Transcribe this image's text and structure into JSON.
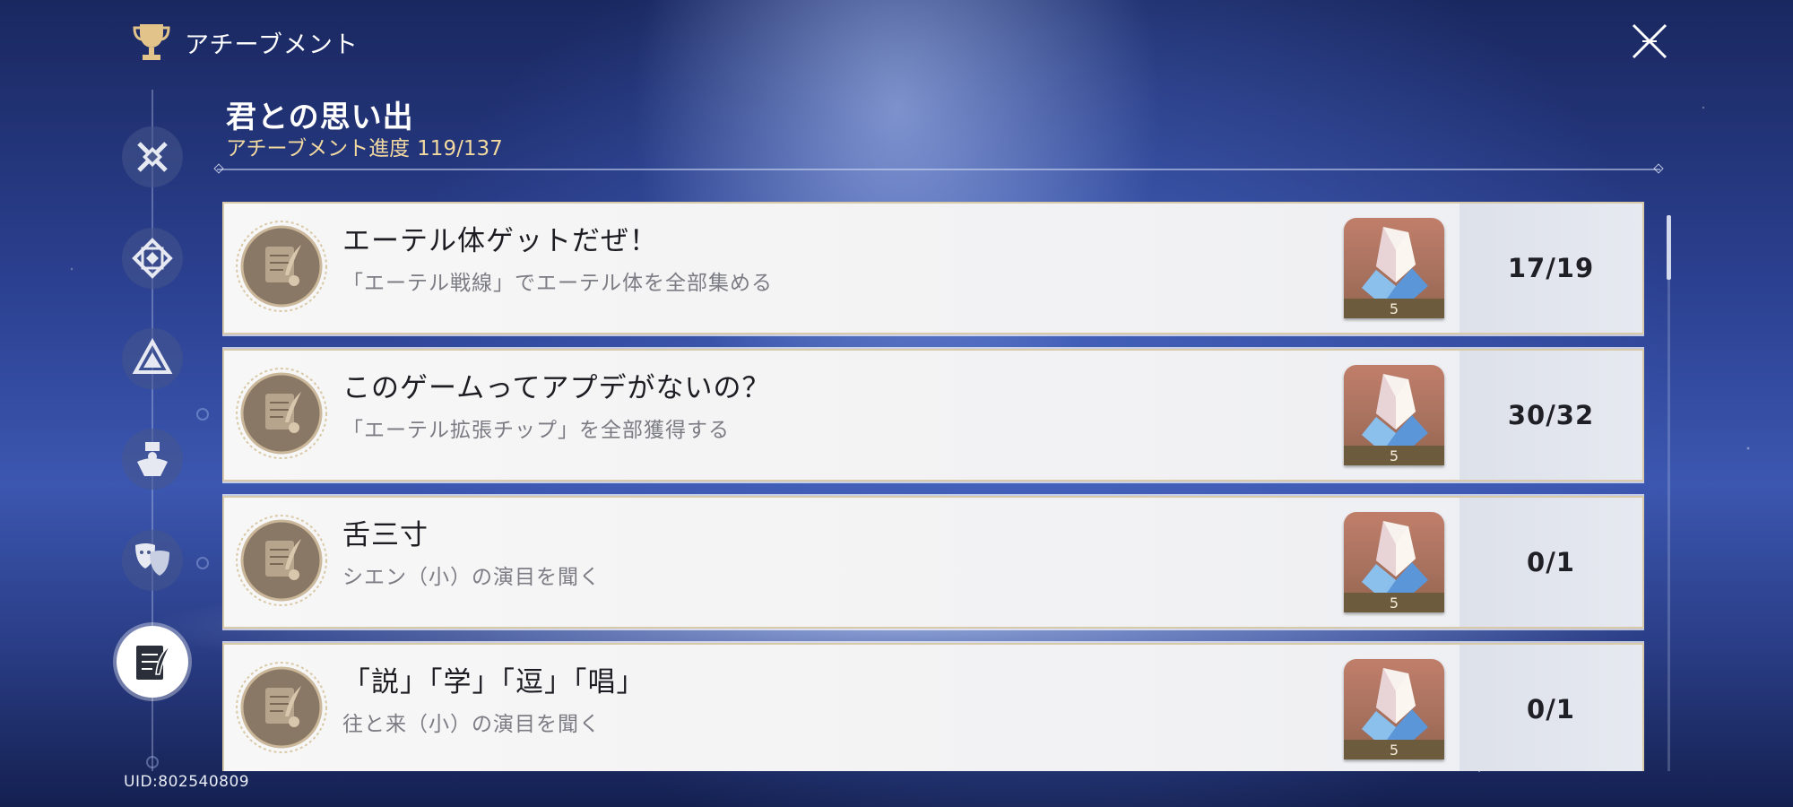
{
  "header": {
    "title": "アチーブメント",
    "icon": "trophy-icon"
  },
  "close": {
    "icon": "close-icon"
  },
  "sidebar": {
    "items": [
      {
        "icon": "crossed-swords-icon",
        "active": false
      },
      {
        "icon": "diamond-emblem-icon",
        "active": false
      },
      {
        "icon": "triangle-emblem-icon",
        "active": false
      },
      {
        "icon": "figure-emblem-icon",
        "active": false
      },
      {
        "icon": "theater-masks-icon",
        "active": false
      },
      {
        "icon": "notebook-quill-icon",
        "active": true
      }
    ]
  },
  "section": {
    "title": "君との思い出",
    "progress_label": "アチーブメント進度",
    "progress_value": "119/137"
  },
  "achievements": [
    {
      "title": "エーテル体ゲットだぜ！",
      "description": "「エーテル戦線」でエーテル体を全部集める",
      "reward_qty": "5",
      "count": "17/19",
      "reward_icon": "crystal-icon",
      "badge_icon": "notebook-badge-icon"
    },
    {
      "title": "このゲームってアプデがないの？",
      "description": "「エーテル拡張チップ」を全部獲得する",
      "reward_qty": "5",
      "count": "30/32",
      "reward_icon": "crystal-icon",
      "badge_icon": "notebook-badge-icon"
    },
    {
      "title": "舌三寸",
      "description": "シエン（小）の演目を聞く",
      "reward_qty": "5",
      "count": "0/1",
      "reward_icon": "crystal-icon",
      "badge_icon": "notebook-badge-icon"
    },
    {
      "title": "「説」「学」「逗」「唱」",
      "description": "往と来（小）の演目を聞く",
      "reward_qty": "5",
      "count": "0/1",
      "reward_icon": "crystal-icon",
      "badge_icon": "notebook-badge-icon"
    }
  ],
  "uid": "UID:802540809",
  "colors": {
    "progress_text": "#f1d9a0",
    "card_border": "#d8c9a8",
    "reward_bg": "#a8725f"
  }
}
